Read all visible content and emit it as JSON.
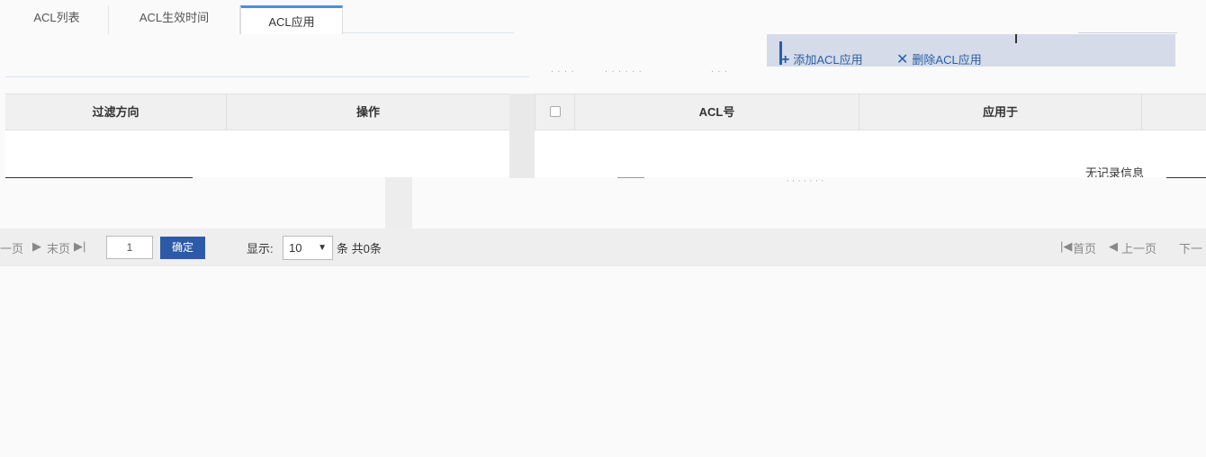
{
  "tabs": [
    {
      "label": "ACL列表"
    },
    {
      "label": "ACL生效时间"
    },
    {
      "label": "ACL应用"
    }
  ],
  "toolbar": {
    "add_label": "添加ACL应用",
    "delete_label": "删除ACL应用",
    "add_icon": "plus-icon",
    "delete_icon": "x-icon"
  },
  "left_table": {
    "columns": [
      "过滤方向",
      "操作"
    ]
  },
  "right_table": {
    "columns": [
      "ACL号",
      "应用于"
    ],
    "empty_text": "无记录信息"
  },
  "pager": {
    "prev_label": "一页",
    "last_label": "末页",
    "page_value": "1",
    "ok_label": "确定",
    "show_label": "显示:",
    "page_size": "10",
    "count_text": "条 共0条",
    "first_label": "首页",
    "prev2_label": "上一页",
    "next_label": "下一"
  },
  "colors": {
    "accent": "#2d5aa6",
    "tab_active_border": "#4a90d9"
  }
}
